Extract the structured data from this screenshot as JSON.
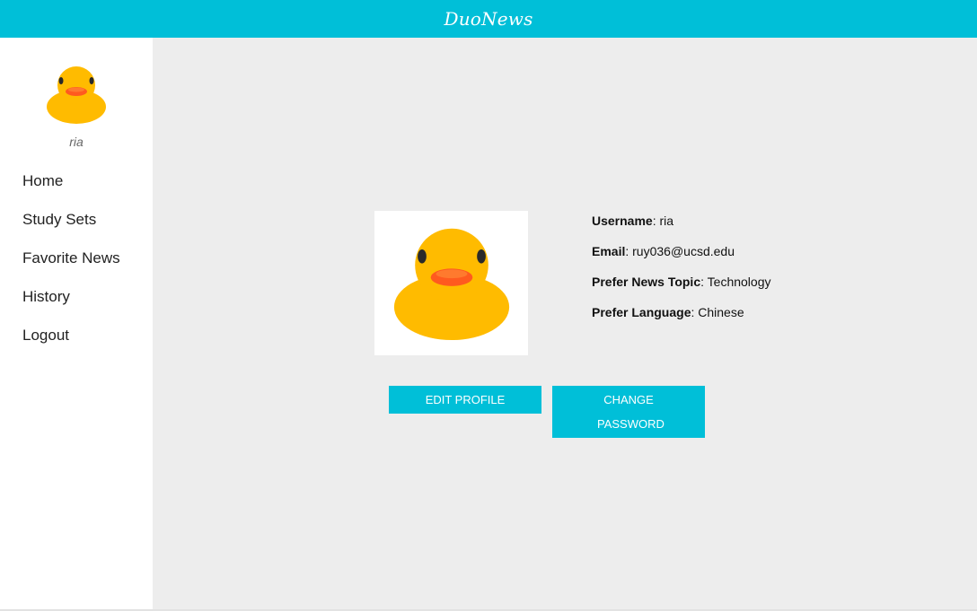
{
  "header": {
    "brand": "DuoNews",
    "color": "#00bfd8"
  },
  "sidebar": {
    "avatar_icon": "rubber-duck-icon",
    "username": "ria",
    "items": [
      {
        "label": "Home"
      },
      {
        "label": "Study Sets"
      },
      {
        "label": "Favorite News"
      },
      {
        "label": "History"
      },
      {
        "label": "Logout"
      }
    ]
  },
  "profile": {
    "picture_icon": "rubber-duck-icon",
    "fields": [
      {
        "label": "Username",
        "value": "ria"
      },
      {
        "label": "Email",
        "value": "ruy036@ucsd.edu"
      },
      {
        "label": "Prefer News Topic",
        "value": "Technology"
      },
      {
        "label": "Prefer Language",
        "value": "Chinese"
      }
    ],
    "separator": ": "
  },
  "buttons": {
    "edit_profile": "Edit Profile",
    "change_password": "Change Password"
  }
}
